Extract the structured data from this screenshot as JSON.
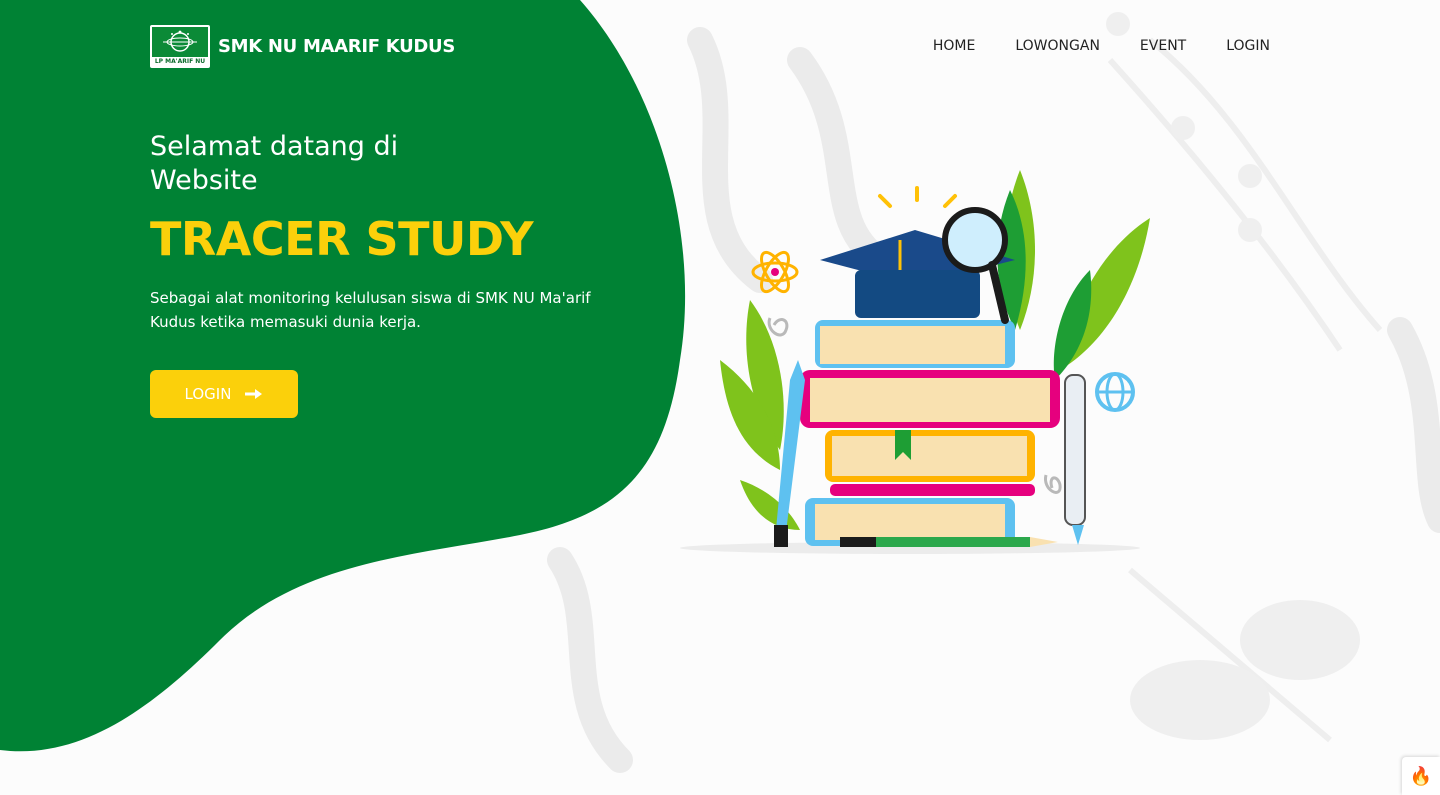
{
  "brand": {
    "name": "SMK NU MAARIF KUDUS",
    "logo_text": "LP MA'ARIF NU",
    "logo_icon": "nu-logo-icon"
  },
  "nav": {
    "items": [
      "HOME",
      "LOWONGAN",
      "EVENT",
      "LOGIN"
    ]
  },
  "hero": {
    "welcome": "Selamat datang di Website",
    "title": "TRACER STUDY",
    "description": "Sebagai alat monitoring kelulusan siswa di SMK NU Ma'arif Kudus ketika memasuki dunia kerja.",
    "button_label": "LOGIN",
    "button_icon": "arrow-right-icon"
  },
  "colors": {
    "primary_green": "#008234",
    "accent_yellow": "#fbd00b",
    "background": "#fcfcfc"
  },
  "corner_widget": {
    "icon": "flame-icon"
  }
}
